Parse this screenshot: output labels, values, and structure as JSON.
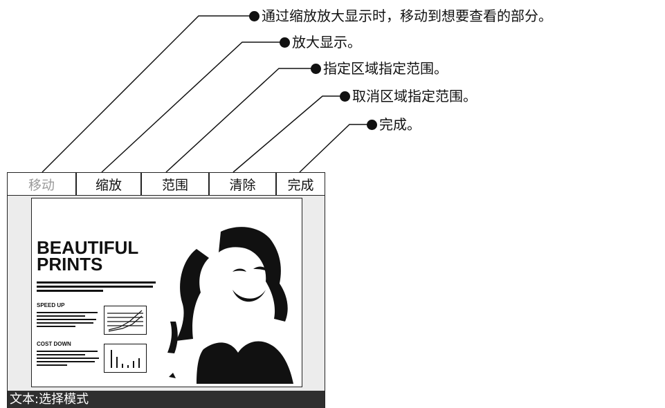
{
  "callouts": [
    {
      "text": "通过缩放放大显示时，移动到想要查看的部分。"
    },
    {
      "text": "放大显示。"
    },
    {
      "text": "指定区域指定范围。"
    },
    {
      "text": "取消区域指定范围。"
    },
    {
      "text": "完成。"
    }
  ],
  "toolbar": {
    "tabs": [
      {
        "label": "移动",
        "enabled": false
      },
      {
        "label": "缩放",
        "enabled": true
      },
      {
        "label": "范围",
        "enabled": true
      },
      {
        "label": "清除",
        "enabled": true
      },
      {
        "label": "完成",
        "enabled": true
      }
    ]
  },
  "preview": {
    "title_line1": "BEAUTIFUL",
    "title_line2": "PRINTS",
    "section1_head": "SPEED UP",
    "section2_head": "COST DOWN"
  },
  "status": {
    "text": "文本:选择模式"
  }
}
